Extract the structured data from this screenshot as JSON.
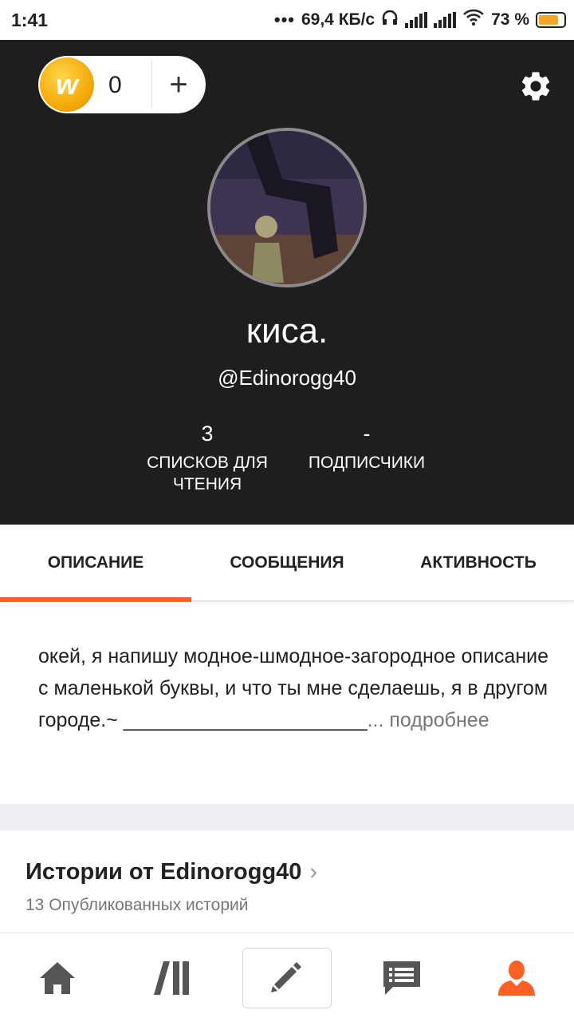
{
  "status_bar": {
    "time": "1:41",
    "network_speed": "69,4 КБ/с",
    "battery_percent": "73 %",
    "battery_level": 0.73
  },
  "header": {
    "coin_count": "0",
    "coin_logo_letter": "w",
    "add_coins_symbol": "+",
    "display_name": "киса.",
    "username": "@Edinorogg40",
    "stats": [
      {
        "value": "3",
        "label": "СПИСКОВ ДЛЯ ЧТЕНИЯ"
      },
      {
        "value": "-",
        "label": "ПОДПИСЧИКИ"
      }
    ]
  },
  "tabs": [
    {
      "label": "ОПИСАНИЕ",
      "active": true
    },
    {
      "label": "СООБЩЕНИЯ",
      "active": false
    },
    {
      "label": "АКТИВНОСТЬ",
      "active": false
    }
  ],
  "description": {
    "text": "окей, я напишу модное-шмодное-загородное описание с маленькой буквы, и что ты мне сделаешь, я в другом городе.~ ______________________",
    "more_label": "... подробнее"
  },
  "stories": {
    "title": "Истории от Edinorogg40",
    "subtitle": "13 Опубликованных историй"
  },
  "colors": {
    "accent": "#ff6122",
    "header_bg": "#1f1d1f",
    "coin_gold": "#f2a400"
  },
  "bottom_nav": {
    "icons": [
      "home-icon",
      "library-icon",
      "pencil-icon",
      "messages-icon",
      "profile-icon"
    ],
    "active": "profile-icon"
  }
}
